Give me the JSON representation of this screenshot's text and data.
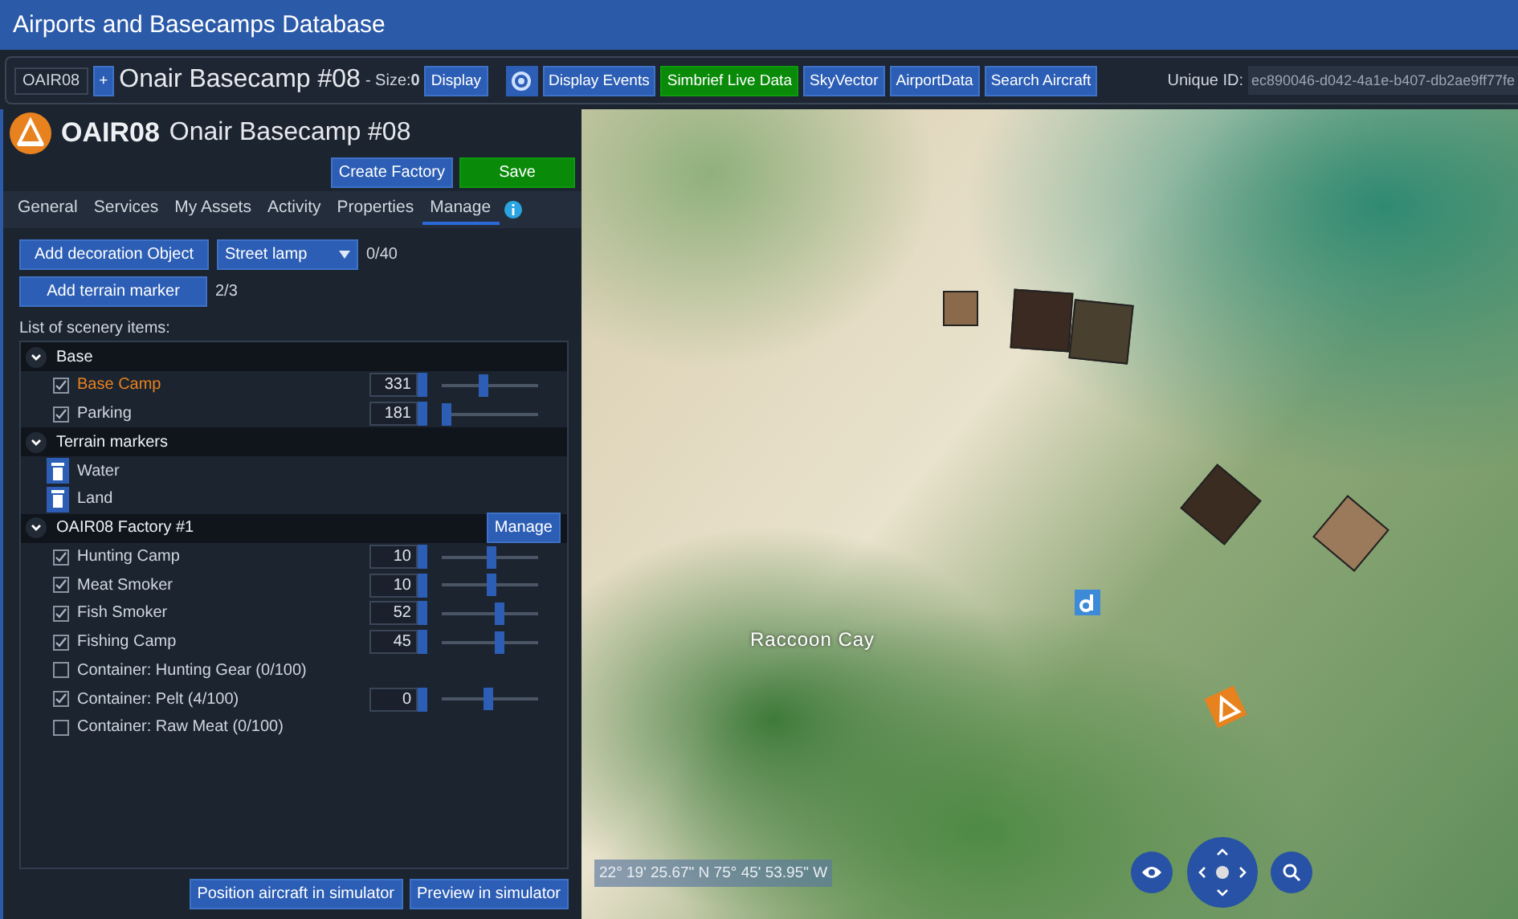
{
  "window": {
    "title": "Airports and Basecamps Database"
  },
  "toolbar": {
    "code": "OAIR08",
    "add": "+",
    "name": "Onair Basecamp #08",
    "size_label": "- Size:",
    "size_value": "0",
    "buttons": [
      {
        "label": "Display",
        "kind": "blue"
      },
      {
        "kind": "icon"
      },
      {
        "label": "Display Events",
        "kind": "blue"
      },
      {
        "label": "Simbrief Live Data",
        "kind": "green"
      },
      {
        "label": "SkyVector",
        "kind": "blue"
      },
      {
        "label": "AirportData",
        "kind": "blue"
      },
      {
        "label": "Search Aircraft",
        "kind": "blue"
      }
    ],
    "unique_id_label": "Unique ID:",
    "unique_id": "ec890046-d042-4a1e-b407-db2ae9ff77fe"
  },
  "header": {
    "code": "OAIR08",
    "name": "Onair Basecamp #08",
    "buttons": [
      {
        "label": "Create Factory",
        "kind": "blue"
      },
      {
        "label": "Save",
        "kind": "green"
      }
    ]
  },
  "tabs": [
    {
      "label": "General",
      "selected": false
    },
    {
      "label": "Services",
      "selected": false
    },
    {
      "label": "My Assets",
      "selected": false
    },
    {
      "label": "Activity",
      "selected": false
    },
    {
      "label": "Properties",
      "selected": false
    },
    {
      "label": "Manage",
      "selected": true
    }
  ],
  "controls": {
    "decoration_button": "Add decoration Object",
    "decoration_select": "Street lamp",
    "decoration_count": "0/40",
    "terrain_button": "Add terrain marker",
    "terrain_count": "2/3"
  },
  "list_label": "List of scenery items:",
  "groups": [
    {
      "title": "Base",
      "expanded": true,
      "items": [
        {
          "kind": "slider",
          "label": "Base Camp",
          "checked": true,
          "selected": true,
          "value": "331",
          "level": 0.42
        },
        {
          "kind": "slider",
          "label": "Parking",
          "checked": true,
          "selected": false,
          "value": "181",
          "level": 0.0
        }
      ]
    },
    {
      "title": "Terrain markers",
      "expanded": true,
      "items": [
        {
          "kind": "marker",
          "label": "Water"
        },
        {
          "kind": "marker",
          "label": "Land"
        }
      ]
    },
    {
      "title": "OAIR08 Factory #1",
      "expanded": true,
      "manage": "Manage",
      "items": [
        {
          "kind": "slider",
          "label": "Hunting Camp",
          "checked": true,
          "selected": false,
          "value": "10",
          "level": 0.52
        },
        {
          "kind": "slider",
          "label": "Meat Smoker",
          "checked": true,
          "selected": false,
          "value": "10",
          "level": 0.52
        },
        {
          "kind": "slider",
          "label": "Fish Smoker",
          "checked": true,
          "selected": false,
          "value": "52",
          "level": 0.62
        },
        {
          "kind": "slider",
          "label": "Fishing Camp",
          "checked": true,
          "selected": false,
          "value": "45",
          "level": 0.61
        },
        {
          "kind": "check",
          "label": "Container: Hunting Gear (0/100)",
          "checked": false,
          "selected": false
        },
        {
          "kind": "slider",
          "label": "Container: Pelt (4/100)",
          "checked": true,
          "selected": false,
          "value": "0",
          "level": 0.48
        },
        {
          "kind": "check",
          "label": "Container: Raw Meat (0/100)",
          "checked": false,
          "selected": false
        }
      ]
    }
  ],
  "footer_buttons": [
    "Position aircraft in simulator",
    "Preview in simulator"
  ],
  "map": {
    "place_label": "Raccoon Cay",
    "coordinates": "22° 19' 25.67\" N 75° 45' 53.95\" W"
  }
}
